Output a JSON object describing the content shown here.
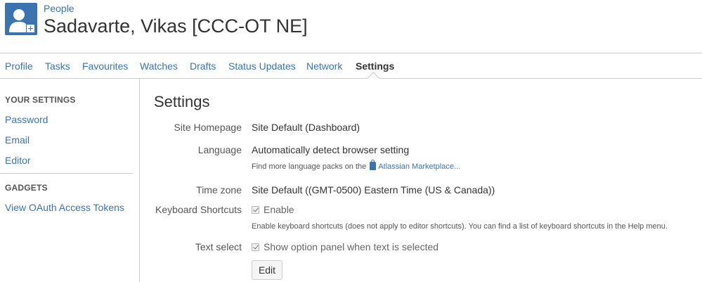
{
  "header": {
    "breadcrumb": "People",
    "title": "Sadavarte, Vikas [CCC-OT NE]",
    "avatar_icon": "user-avatar-icon",
    "accent": "#3b73af"
  },
  "tabs": [
    {
      "label": "Profile"
    },
    {
      "label": "Tasks"
    },
    {
      "label": "Favourites"
    },
    {
      "label": "Watches"
    },
    {
      "label": "Drafts"
    },
    {
      "label": "Status Updates"
    },
    {
      "label": "Network"
    },
    {
      "label": "Settings",
      "active": true
    }
  ],
  "sidebar": {
    "your_settings_heading": "YOUR SETTINGS",
    "your_settings_items": [
      {
        "label": "Password"
      },
      {
        "label": "Email"
      },
      {
        "label": "Editor"
      }
    ],
    "gadgets_heading": "GADGETS",
    "gadgets_items": [
      {
        "label": "View OAuth Access Tokens"
      }
    ]
  },
  "settings": {
    "title": "Settings",
    "site_homepage": {
      "label": "Site Homepage",
      "value": "Site Default (Dashboard)"
    },
    "language": {
      "label": "Language",
      "value": "Automatically detect browser setting",
      "note_prefix": "Find more language packs on the",
      "note_link": "Atlassian Marketplace..."
    },
    "time_zone": {
      "label": "Time zone",
      "value": "Site Default ((GMT-0500) Eastern Time (US & Canada))"
    },
    "keyboard_shortcuts": {
      "label": "Keyboard Shortcuts",
      "checked": true,
      "value": "Enable",
      "note": "Enable keyboard shortcuts (does not apply to editor shortcuts). You can find a list of keyboard shortcuts in the Help menu."
    },
    "text_select": {
      "label": "Text select",
      "checked": true,
      "value": "Show option panel when text is selected"
    },
    "edit_label": "Edit"
  }
}
